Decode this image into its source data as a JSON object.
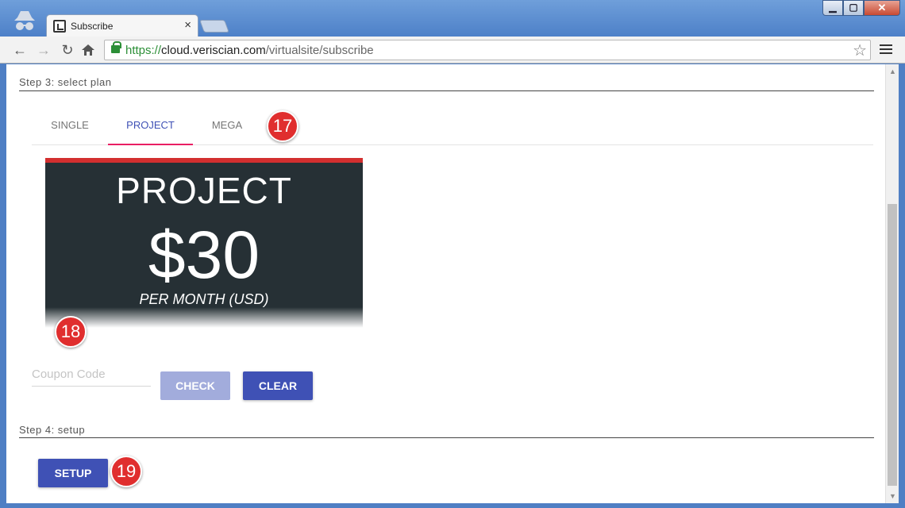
{
  "browser": {
    "tab_title": "Subscribe",
    "tab_close": "×",
    "url_scheme": "https://",
    "url_host": "cloud.veriscian.com",
    "url_path": "/virtualsite/subscribe",
    "controls": {
      "minimize": "▁",
      "maximize": "▢",
      "close": "✕"
    },
    "icons": [
      "incognito-icon",
      "back-icon",
      "forward-icon",
      "reload-icon",
      "home-icon",
      "lock-icon",
      "bookmark-star-icon",
      "menu-icon"
    ]
  },
  "step3": {
    "label": "Step 3: select plan",
    "tabs": [
      {
        "label": "SINGLE",
        "active": false
      },
      {
        "label": "PROJECT",
        "active": true
      },
      {
        "label": "MEGA",
        "active": false
      }
    ],
    "plan_card": {
      "name": "PROJECT",
      "price": "$30",
      "period": "PER MONTH (USD)"
    },
    "coupon": {
      "placeholder": "Coupon Code",
      "value": ""
    },
    "check_label": "CHECK",
    "clear_label": "CLEAR"
  },
  "step4": {
    "label": "Step 4: setup",
    "setup_label": "SETUP"
  },
  "callouts": [
    "17",
    "18",
    "19"
  ],
  "colors": {
    "accent": "#3f51b5",
    "tab_indicator": "#e91e63",
    "card_bg": "#263035",
    "card_stripe": "#d32f2f",
    "callout": "#e02e2e",
    "ssl_green": "#2c8f37"
  }
}
